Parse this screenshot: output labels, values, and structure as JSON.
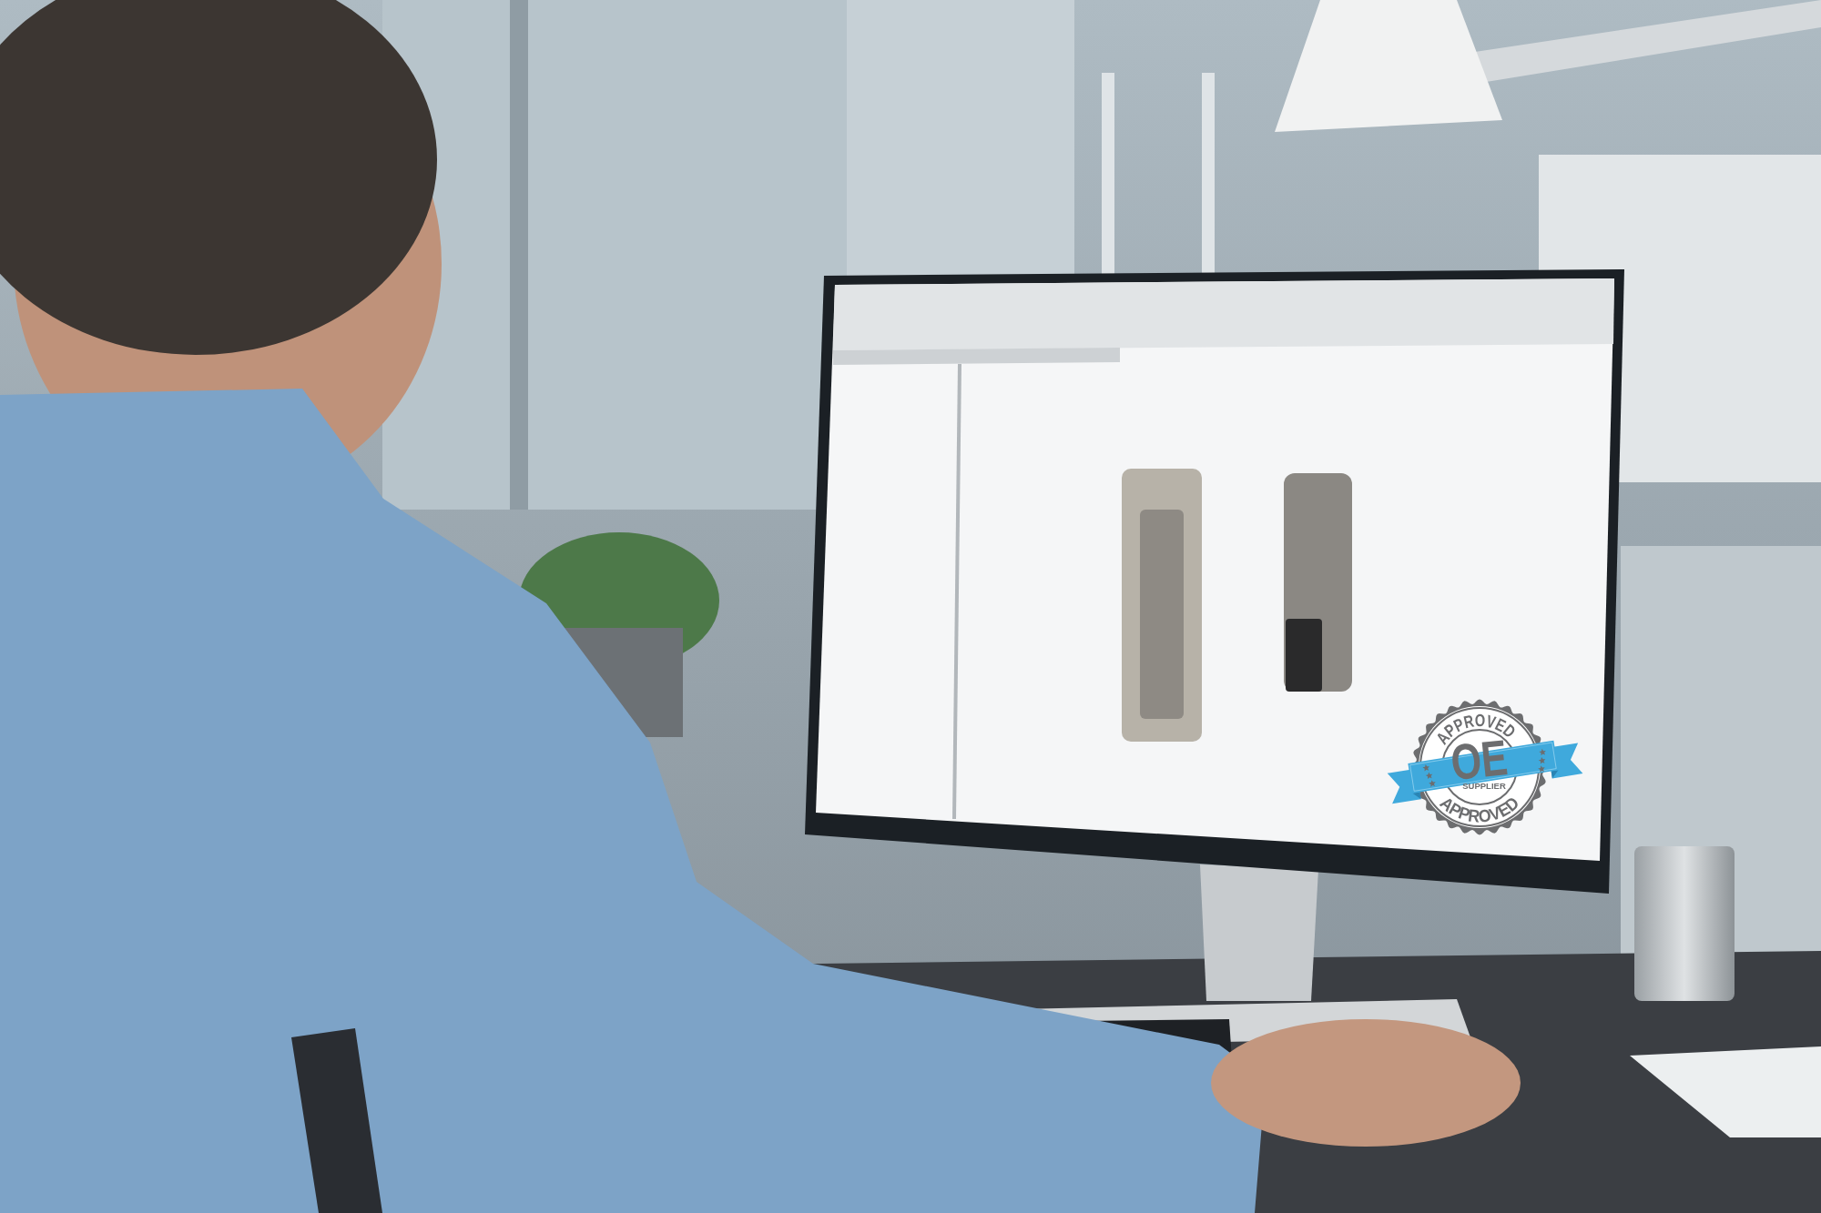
{
  "badge": {
    "top_text": "APPROVED",
    "title": "OE",
    "subtitle": "SUPPLIER",
    "bottom_text": "APPROVED"
  }
}
